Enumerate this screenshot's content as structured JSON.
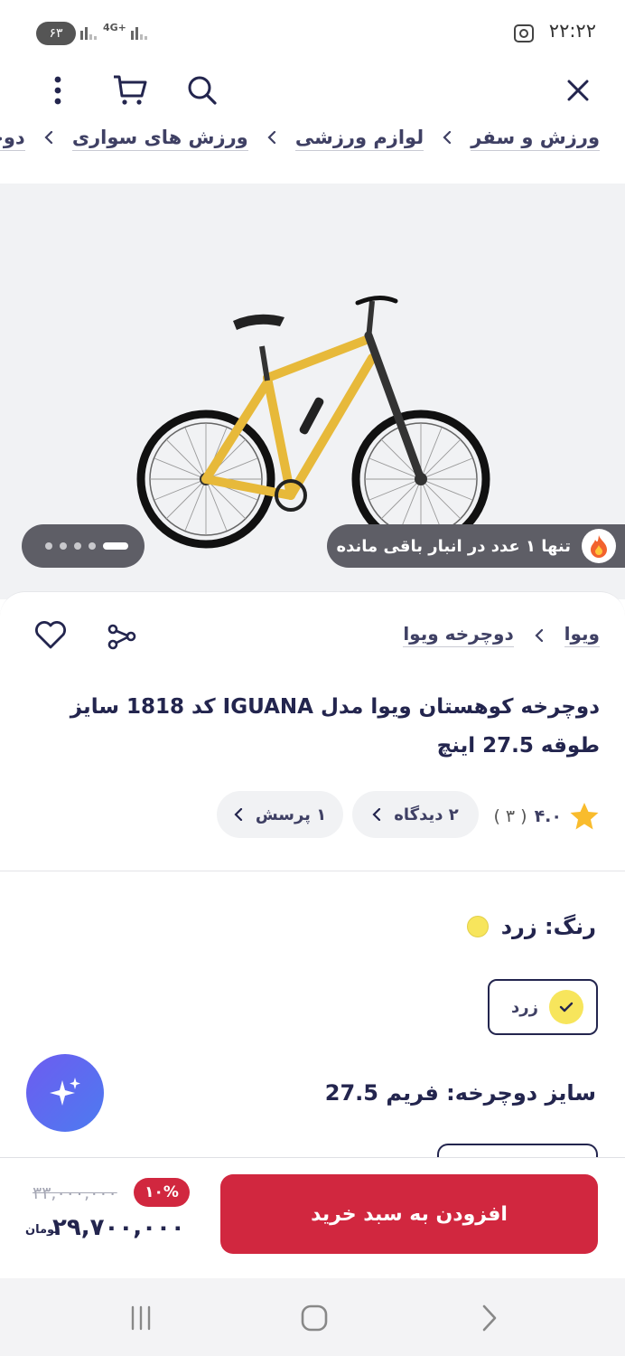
{
  "status_bar": {
    "time": "۲۲:۲۲",
    "battery": "۶۳",
    "network": "4G+"
  },
  "breadcrumb": [
    "ورزش و سفر",
    "لوازم ورزشی",
    "ورزش های سواری",
    "دوچرخه سواری"
  ],
  "gallery": {
    "stock_notice": "تنها ۱ عدد در انبار باقی مانده",
    "image_count": 5,
    "active_index": 0
  },
  "product": {
    "brand": "ویوا",
    "category": "دوچرخه ویوا",
    "title": "دوچرخه کوهستان ویوا مدل IGUANA کد 1818 سایز طوقه 27.5 اینچ",
    "rating": "۴.۰",
    "rating_count": "( ۳ )",
    "reviews_label": "۲ دیدگاه",
    "questions_label": "۱ پرسش"
  },
  "color": {
    "label": "رنگ: زرد",
    "selected": "زرد",
    "hex": "#f7e55c"
  },
  "size": {
    "label": "سایز دوچرخه: فریم 27.5"
  },
  "purchase": {
    "button_label": "افزودن به سبد خرید",
    "old_price": "۳۳,۰۰۰,۰۰۰",
    "discount": "۱۰%",
    "price": "۲۹,۷۰۰,۰۰۰",
    "currency": "تومان"
  },
  "colors": {
    "accent": "#d1273f",
    "text": "#23254e",
    "ai_gradient": [
      "#6d5cf0",
      "#4d7bf0"
    ]
  }
}
